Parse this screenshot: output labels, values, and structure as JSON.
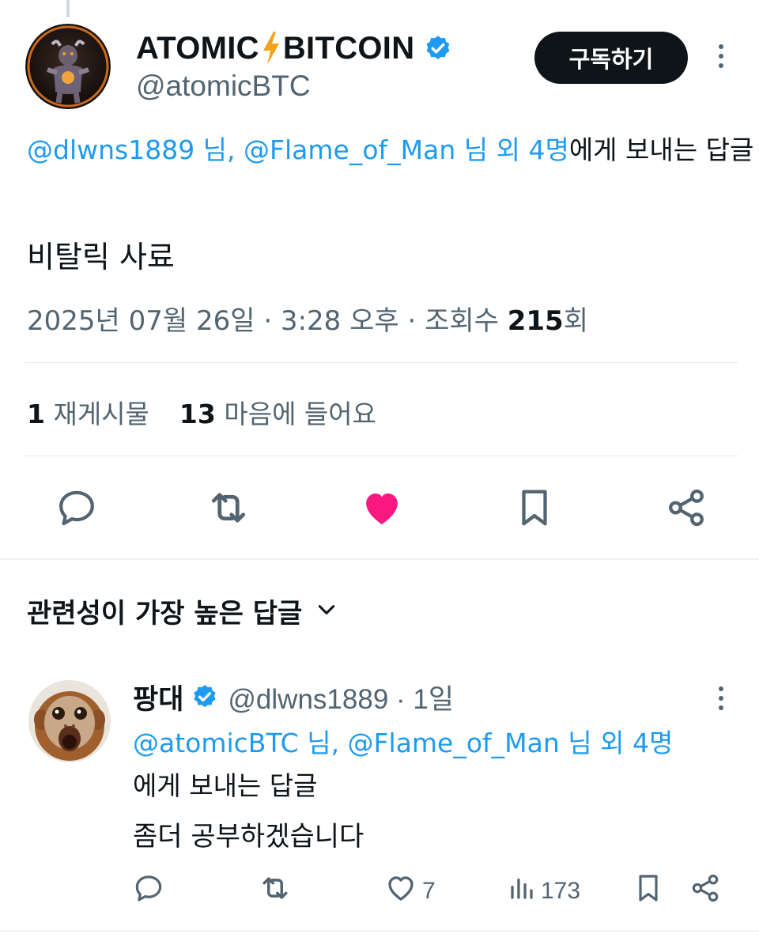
{
  "colors": {
    "link": "#1d9bf0",
    "verified": "#1d9bf0",
    "like_active": "#f91880",
    "text_secondary": "#536471"
  },
  "tweet": {
    "author": {
      "name_left": "ATOMIC",
      "name_right": "BITCOIN",
      "handle": "@atomicBTC",
      "verified": true
    },
    "subscribe_label": "구독하기",
    "reply_to": {
      "link_text": "@dlwns1889 님, @Flame_of_Man 님 외 4명",
      "suffix": "에게 보내는 답글"
    },
    "text": "비탈릭 사료",
    "meta": {
      "prefix": "2025년 07월 26일 · 3:28 오후 · 조회수 ",
      "views": "215",
      "suffix": "회"
    },
    "stats": {
      "reposts_count": "1",
      "reposts_label": "재게시물",
      "likes_count": "13",
      "likes_label": "마음에 들어요"
    },
    "actions": [
      "reply-icon",
      "retweet-icon",
      "heart-filled-icon",
      "bookmark-icon",
      "share-icon"
    ]
  },
  "replies_section": {
    "sort_label": "관련성이 가장 높은 답글"
  },
  "reply": {
    "name": "팡대",
    "verified": true,
    "handle_time": "@dlwns1889 · 1일",
    "reply_to": {
      "link_text": "@atomicBTC 님, @Flame_of_Man 님 외 4명",
      "suffix": "에게 보내는 답글"
    },
    "text": "좀더 공부하겠습니다",
    "likes": "7",
    "views": "173"
  }
}
